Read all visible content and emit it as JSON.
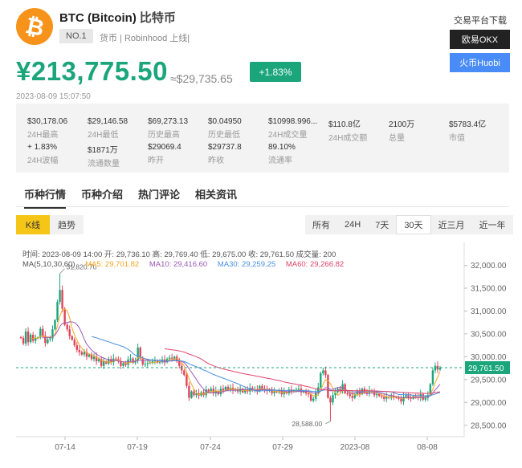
{
  "coin": {
    "logo_symbol": "₿",
    "name": "BTC (Bitcoin)",
    "cn_name": "比特币",
    "rank": "NO.1",
    "tags": "货币 | Robinhood 上线|"
  },
  "download": {
    "title": "交易平台下载",
    "okx": "欧易OKX",
    "huobi": "火币Huobi"
  },
  "price": {
    "cny": "¥213,775.50",
    "usd": "≈$29,735.65",
    "change": "+1.83%",
    "timestamp": "2023-08-09 15:07:50"
  },
  "stats": [
    {
      "value": "$30,178.06",
      "label": "24H最高"
    },
    {
      "value": "$29,146.58",
      "label": "24H最低"
    },
    {
      "value": "$69,273.13",
      "label": "历史最高"
    },
    {
      "value": "$0.04950",
      "label": "历史最低"
    },
    {
      "value": "$10998.996...",
      "label": "24H成交量"
    },
    {
      "value": "$110.8亿",
      "label": "24H成交额"
    },
    {
      "value": "2100万",
      "label": "总量"
    },
    {
      "value": "$5783.4亿",
      "label": "市值"
    },
    {
      "value": "+ 1.83%",
      "label": "24H波幅"
    },
    {
      "value": "$1871万",
      "label": "流通数量"
    },
    {
      "value": "$29069.4",
      "label": "昨开"
    },
    {
      "value": "$29737.8",
      "label": "昨收"
    },
    {
      "value": "89.10%",
      "label": "流通率"
    }
  ],
  "tabs": [
    "币种行情",
    "币种介绍",
    "热门评论",
    "相关资讯"
  ],
  "chart_type_toggle": [
    "K线",
    "趋势"
  ],
  "ranges": [
    "所有",
    "24H",
    "7天",
    "30天",
    "近三月",
    "近一年"
  ],
  "chart_info": {
    "ohlc": "时间: 2023-08-09 14:00   开: 29,736.10   高: 29,769.40   低: 29,675.00   收: 29,761.50   成交量: 200",
    "ma_label": "MA(5,10,30,60)",
    "ma5": "MA5: 29,701.82",
    "ma10": "MA10: 29,416.60",
    "ma30": "MA30: 29,259.25",
    "ma60": "MA60: 29,266.82"
  },
  "colors": {
    "up": "#1aa57a",
    "down": "#e0445a",
    "ma5": "#f5a623",
    "ma10": "#9b59b6",
    "ma30": "#4a90e2",
    "ma60": "#e0446a"
  },
  "chart_data": {
    "type": "candlestick",
    "x_ticks": [
      "07-14",
      "07-19",
      "07-24",
      "07-29",
      "2023-08",
      "08-08"
    ],
    "y_ticks": [
      28500,
      29000,
      29500,
      30000,
      30500,
      31000,
      31500,
      32000
    ],
    "ylim": [
      28250,
      32150
    ],
    "current_price": 29761.5,
    "current_price_label": "29,761.50",
    "high_annotation": {
      "value": 31820.7,
      "label": "31,820.70"
    },
    "low_annotation": {
      "value": 28588.0,
      "label": "28,588.00"
    },
    "closes": [
      30410,
      30290,
      30550,
      30320,
      30480,
      30350,
      30400,
      30420,
      30610,
      30460,
      30300,
      30380,
      30400,
      30600,
      30800,
      31200,
      31460,
      31050,
      30700,
      30600,
      30450,
      30370,
      30250,
      30150,
      30100,
      30050,
      30100,
      30000,
      30050,
      29950,
      30000,
      29900,
      29950,
      29800,
      29900,
      29850,
      29950,
      29880,
      29960,
      29950,
      29900,
      29800,
      29860,
      29820,
      29940,
      29960,
      29870,
      29920,
      30200,
      29960,
      29830,
      29840,
      29860,
      29880,
      29900,
      29920,
      29870,
      29900,
      29940,
      29880,
      29950,
      29980,
      29960,
      30000,
      29900,
      29800,
      29700,
      29600,
      29360,
      29100,
      29240,
      29160,
      29200,
      29150,
      29220,
      29160,
      29280,
      29240,
      29300,
      29200,
      29250,
      29180,
      29300,
      29260,
      29340,
      29280,
      29320,
      29260,
      29280,
      29240,
      29300,
      29220,
      29280,
      29240,
      29320,
      29260,
      29290,
      29240,
      29360,
      29300,
      29270,
      29250,
      29280,
      29200,
      29240,
      29220,
      29260,
      29180,
      29230,
      29200,
      29280,
      29240,
      29260,
      29280,
      29300,
      29220,
      29240,
      29200,
      29180,
      29040,
      29080,
      29220,
      29330,
      29640,
      29700,
      29600,
      29100,
      29000,
      29160,
      29220,
      29300,
      29260,
      29400,
      29200,
      29180,
      29140,
      29100,
      29180,
      29240,
      29180,
      29300,
      29220,
      29200,
      29260,
      29240,
      29160,
      29180,
      29140,
      29120,
      29080,
      29120,
      29100,
      29140,
      29120,
      29100,
      29080,
      29020,
      29120,
      29160,
      29100,
      29080,
      29140,
      29120,
      29100,
      29180,
      29060,
      29100,
      29160,
      29400,
      29700,
      29800,
      29720,
      29762
    ]
  }
}
